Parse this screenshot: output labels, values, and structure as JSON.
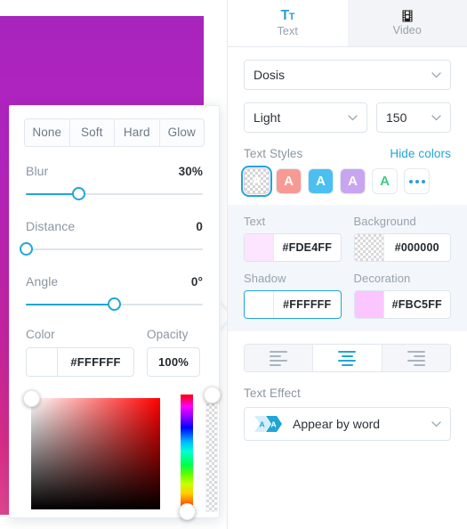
{
  "canvas": {
    "name": "slide-canvas",
    "gradient_top": "#A724BD",
    "gradient_bottom": "#E0458F"
  },
  "shadow_popover": {
    "segments": [
      {
        "label": "None",
        "selected": false
      },
      {
        "label": "Soft",
        "selected": false
      },
      {
        "label": "Hard",
        "selected": false
      },
      {
        "label": "Glow",
        "selected": false
      }
    ],
    "sliders": [
      {
        "label": "Blur",
        "value": "30%",
        "percent": 30
      },
      {
        "label": "Distance",
        "value": "0",
        "percent": 0
      },
      {
        "label": "Angle",
        "value": "0°",
        "percent": 50
      }
    ],
    "color": {
      "label": "Color",
      "value": "#FFFFFF",
      "swatch": "#FFFFFF"
    },
    "opacity": {
      "label": "Opacity",
      "value": "100%"
    },
    "picker": {
      "hue_handle_percent": 96,
      "alpha_handle_percent": 0,
      "sv_handle_x": 0,
      "sv_handle_y": 0
    }
  },
  "right_panel": {
    "tabs": [
      {
        "label": "Text",
        "icon": "tt-icon",
        "active": true
      },
      {
        "label": "Video",
        "icon": "film-icon",
        "active": false
      }
    ],
    "font_family": {
      "value": "Dosis"
    },
    "font_weight": {
      "value": "Light"
    },
    "font_size": {
      "value": "150"
    },
    "text_styles": {
      "title": "Text Styles",
      "toggle_link": "Hide colors",
      "swatches": [
        {
          "name": "transparent",
          "fill": "transparent",
          "letter": "A",
          "letter_color": "#FFFFFF",
          "selected": true
        },
        {
          "name": "salmon",
          "fill": "#F79A93",
          "letter": "A",
          "letter_color": "#FFFFFF",
          "selected": false
        },
        {
          "name": "sky",
          "fill": "#4BC0F0",
          "letter": "A",
          "letter_color": "#FFFFFF",
          "selected": false
        },
        {
          "name": "lavender",
          "fill": "#C9A5F0",
          "letter": "A",
          "letter_color": "#FFFFFF",
          "selected": false
        },
        {
          "name": "white-green",
          "fill": "#FFFFFF",
          "letter": "A",
          "letter_color": "#3DCB84",
          "selected": false
        },
        {
          "name": "more",
          "fill": "#FFFFFF",
          "letter": "",
          "letter_color": "#2B9FD6",
          "selected": false
        }
      ]
    },
    "colors": {
      "text": {
        "label": "Text",
        "value": "#FDE4FF",
        "swatch": "#FDE4FF",
        "checker": false,
        "focused": false
      },
      "background": {
        "label": "Background",
        "value": "#000000",
        "swatch": "transparent",
        "checker": true,
        "focused": false
      },
      "shadow": {
        "label": "Shadow",
        "value": "#FFFFFF",
        "swatch": "#FFFFFF",
        "checker": false,
        "focused": true
      },
      "decoration": {
        "label": "Decoration",
        "value": "#FBC5FF",
        "swatch": "#FBC5FF",
        "checker": false,
        "focused": false
      }
    },
    "alignment": [
      {
        "name": "align-left",
        "selected": false
      },
      {
        "name": "align-center",
        "selected": true
      },
      {
        "name": "align-right",
        "selected": false
      }
    ],
    "text_effect": {
      "label": "Text Effect",
      "value": "Appear by word",
      "icon": "aa-effect-icon"
    }
  },
  "accent": {
    "blue": "#1EA7D6",
    "link": "#22A5DB",
    "muted": "#8B97A3"
  }
}
